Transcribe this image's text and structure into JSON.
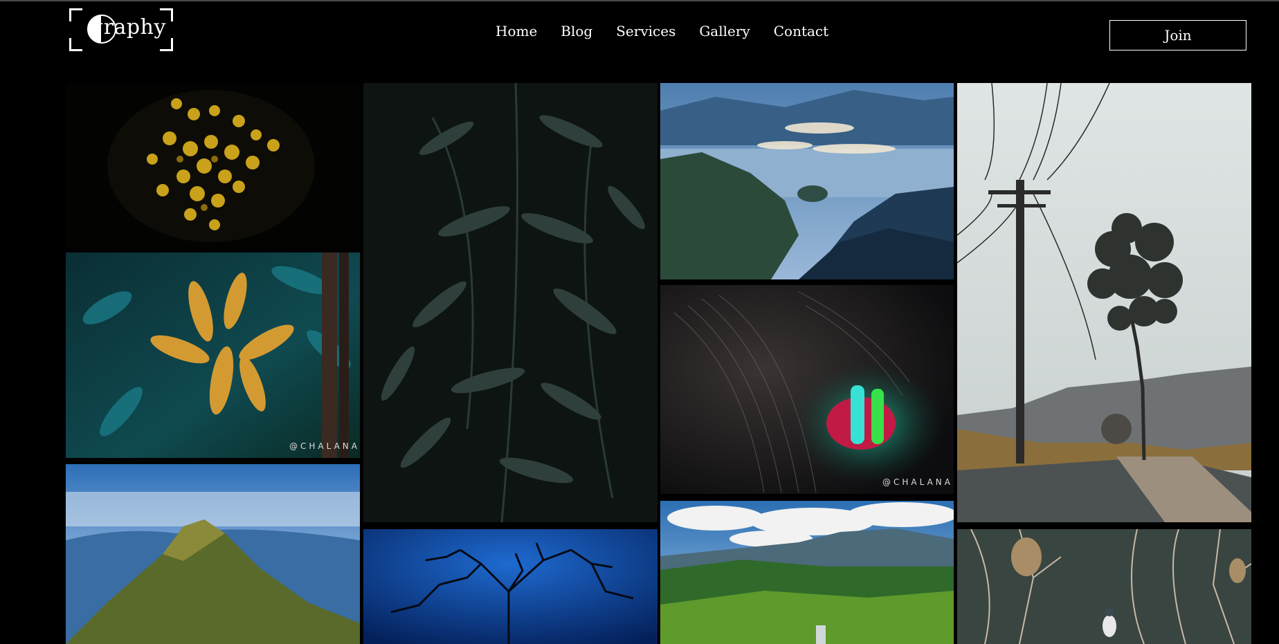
{
  "logo": {
    "text": "graphy"
  },
  "nav": {
    "items": [
      "Home",
      "Blog",
      "Services",
      "Gallery",
      "Contact"
    ]
  },
  "join_label": "Join",
  "watermark": "@CHALANA",
  "gallery": [
    {
      "subject": "yellow-flowers"
    },
    {
      "subject": "golden-leaves"
    },
    {
      "subject": "mountain-peak"
    },
    {
      "subject": "dark-ferns"
    },
    {
      "subject": "bare-tree-blue-sky"
    },
    {
      "subject": "lake-mountains"
    },
    {
      "subject": "book-glow"
    },
    {
      "subject": "green-valley"
    },
    {
      "subject": "power-pole-tree"
    },
    {
      "subject": "dry-branches"
    }
  ]
}
